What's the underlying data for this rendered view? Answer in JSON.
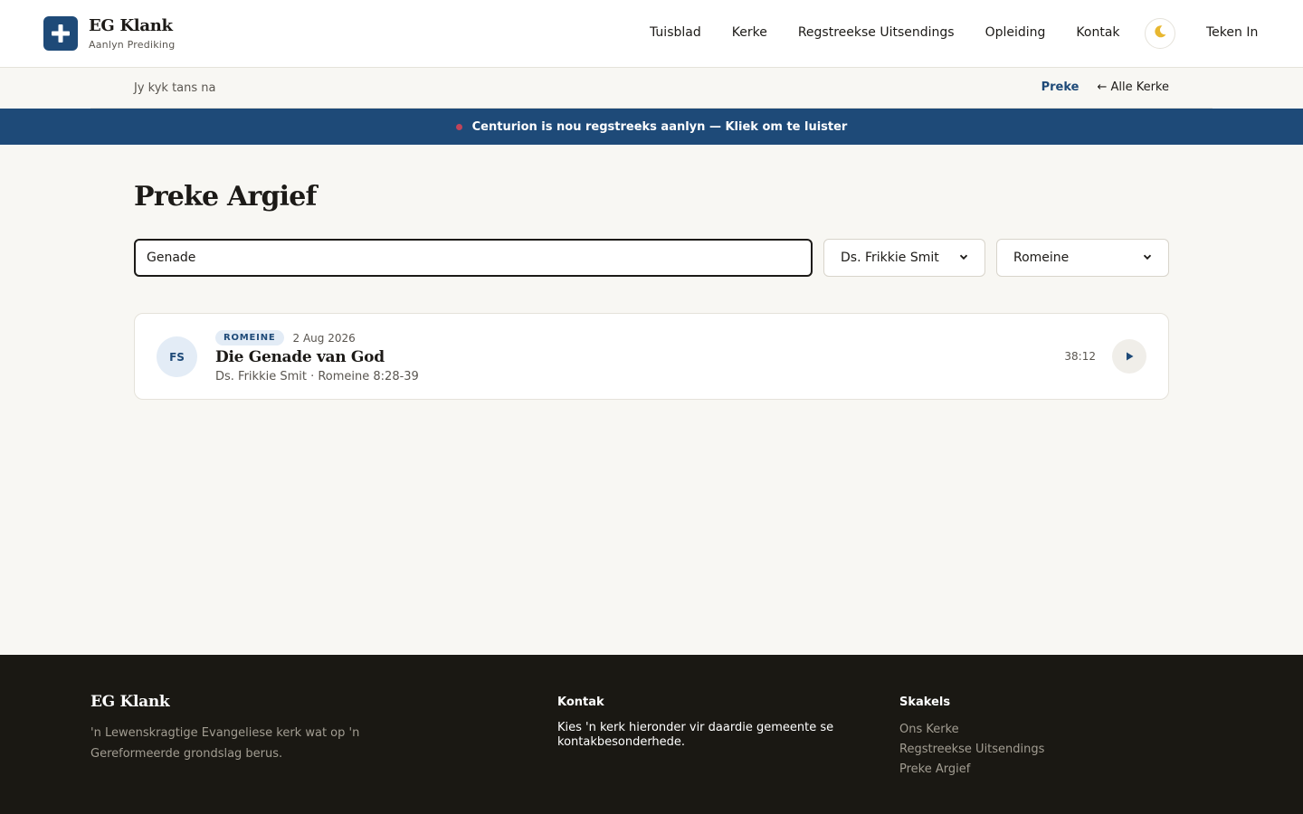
{
  "brand": {
    "name": "EG Klank",
    "subtitle": "Aanlyn Prediking",
    "logo_icon": "plus-cross-icon"
  },
  "nav": {
    "items": [
      {
        "label": "Tuisblad"
      },
      {
        "label": "Kerke"
      },
      {
        "label": "Regstreekse Uitsendings"
      },
      {
        "label": "Opleiding"
      },
      {
        "label": "Kontak"
      }
    ],
    "theme_toggle_icon": "moon-icon",
    "signin_label": "Teken In"
  },
  "context": {
    "label": "Jy kyk tans na",
    "active_link": "Preke",
    "back_link": "← Alle Kerke"
  },
  "live_banner": {
    "text": "Centurion is nou regstreeks aanlyn — Kliek om te luister",
    "dot_color": "#c0445a"
  },
  "main": {
    "title": "Preke Argief",
    "search": {
      "value": "Genade",
      "placeholder": ""
    },
    "filters": {
      "speaker": "Ds. Frikkie Smit",
      "book": "Romeine"
    }
  },
  "sermons": [
    {
      "initials": "FS",
      "badge": "ROMEINE",
      "date": "2 Aug 2026",
      "title": "Die Genade van God",
      "subtitle": "Ds. Frikkie Smit · Romeine 8:28-39",
      "duration": "38:12",
      "play_icon": "play-icon"
    }
  ],
  "footer": {
    "brand": "EG Klank",
    "tagline": "'n Lewenskragtige Evangeliese kerk wat op 'n Gereformeerde grondslag berus.",
    "contact_title": "Kontak",
    "contact_text": "Kies 'n kerk hieronder vir daardie gemeente se kontakbesonderhede.",
    "links_title": "Skakels",
    "links": [
      {
        "label": "Ons Kerke"
      },
      {
        "label": "Regstreekse Uitsendings"
      },
      {
        "label": "Preke Argief"
      }
    ]
  },
  "colors": {
    "primary": "#1e4a78",
    "background": "#f8f7f3",
    "footer_bg": "#1a1813",
    "badge_bg": "#e3ecf6"
  }
}
